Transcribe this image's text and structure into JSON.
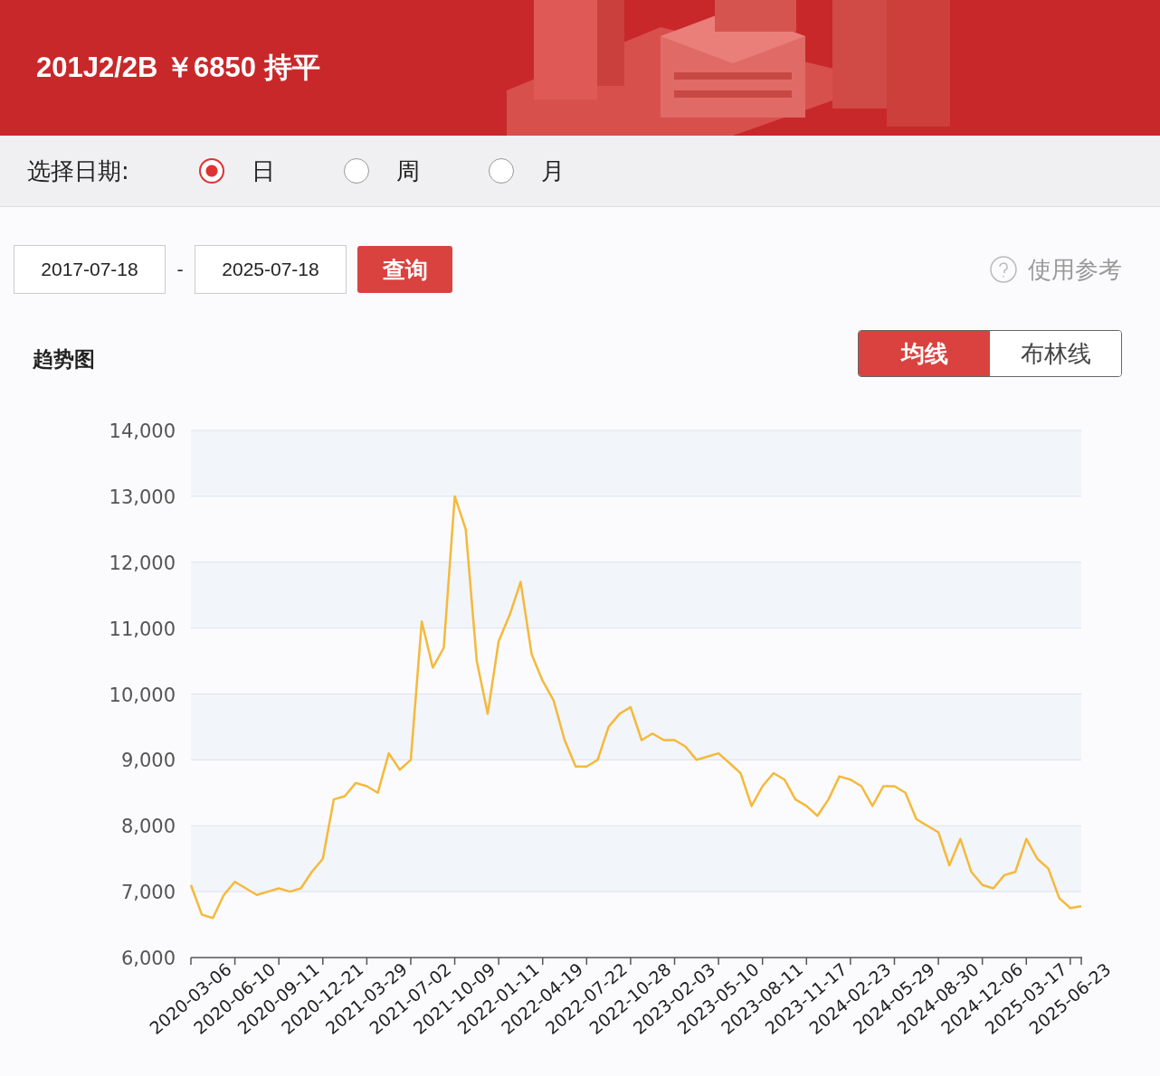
{
  "header": {
    "title": "201J2/2B ￥6850 持平"
  },
  "date_filter": {
    "label": "选择日期:",
    "options": [
      {
        "label": "日",
        "selected": true
      },
      {
        "label": "周",
        "selected": false
      },
      {
        "label": "月",
        "selected": false
      }
    ]
  },
  "range": {
    "start": "2017-07-18",
    "separator": "-",
    "end": "2025-07-18",
    "query_button": "查询",
    "help_link": "使用参考"
  },
  "chart_panel": {
    "title": "趋势图",
    "modes": [
      {
        "label": "均线",
        "selected": true
      },
      {
        "label": "布林线",
        "selected": false
      }
    ],
    "chart_data": {
      "type": "line",
      "grid": true,
      "ylim": [
        6000,
        14000
      ],
      "categories": [
        "2020-03-06",
        null,
        null,
        null,
        "2020-06-10",
        null,
        null,
        null,
        "2020-09-11",
        null,
        null,
        null,
        "2020-12-21",
        null,
        null,
        null,
        "2021-03-29",
        null,
        null,
        null,
        "2021-07-02",
        null,
        null,
        null,
        "2021-10-09",
        null,
        null,
        null,
        "2022-01-11",
        null,
        null,
        null,
        "2022-04-19",
        null,
        null,
        null,
        "2022-07-22",
        null,
        null,
        null,
        "2022-10-28",
        null,
        null,
        null,
        "2023-02-03",
        null,
        null,
        null,
        "2023-05-10",
        null,
        null,
        null,
        "2023-08-11",
        null,
        null,
        null,
        "2023-11-17",
        null,
        null,
        null,
        "2024-02-23",
        null,
        null,
        null,
        "2024-05-29",
        null,
        null,
        null,
        "2024-08-30",
        null,
        null,
        null,
        "2024-12-06",
        null,
        null,
        null,
        "2025-03-17",
        null,
        null,
        null,
        "2025-06-23",
        null
      ],
      "series": [
        {
          "color": "#f5b93a",
          "values": [
            7100,
            6650,
            6600,
            6950,
            7150,
            7050,
            6950,
            7000,
            7050,
            7000,
            7050,
            7300,
            7500,
            8400,
            8450,
            8650,
            8600,
            8500,
            9100,
            8850,
            9000,
            11100,
            10400,
            10700,
            13000,
            12500,
            10500,
            9700,
            10800,
            11200,
            11700,
            10600,
            10200,
            9900,
            9300,
            8900,
            8900,
            9000,
            9500,
            9700,
            9800,
            9300,
            9400,
            9300,
            9300,
            9200,
            9000,
            9050,
            9100,
            8950,
            8800,
            8300,
            8600,
            8800,
            8700,
            8400,
            8300,
            8150,
            8400,
            8750,
            8700,
            8600,
            8300,
            8600,
            8600,
            8500,
            8100,
            8000,
            7900,
            7400,
            7800,
            7300,
            7100,
            7050,
            7250,
            7300,
            7800,
            7500,
            7350,
            6900,
            6750,
            6780
          ]
        }
      ],
      "yticks": [
        {
          "value": 6000,
          "label": "6,000"
        },
        {
          "value": 7000,
          "label": "7,000"
        },
        {
          "value": 8000,
          "label": "8,000"
        },
        {
          "value": 9000,
          "label": "9,000"
        },
        {
          "value": 10000,
          "label": "10,000"
        },
        {
          "value": 11000,
          "label": "11,000"
        },
        {
          "value": 12000,
          "label": "12,000"
        },
        {
          "value": 13000,
          "label": "13,000"
        },
        {
          "value": 14000,
          "label": "14,000"
        }
      ]
    }
  }
}
